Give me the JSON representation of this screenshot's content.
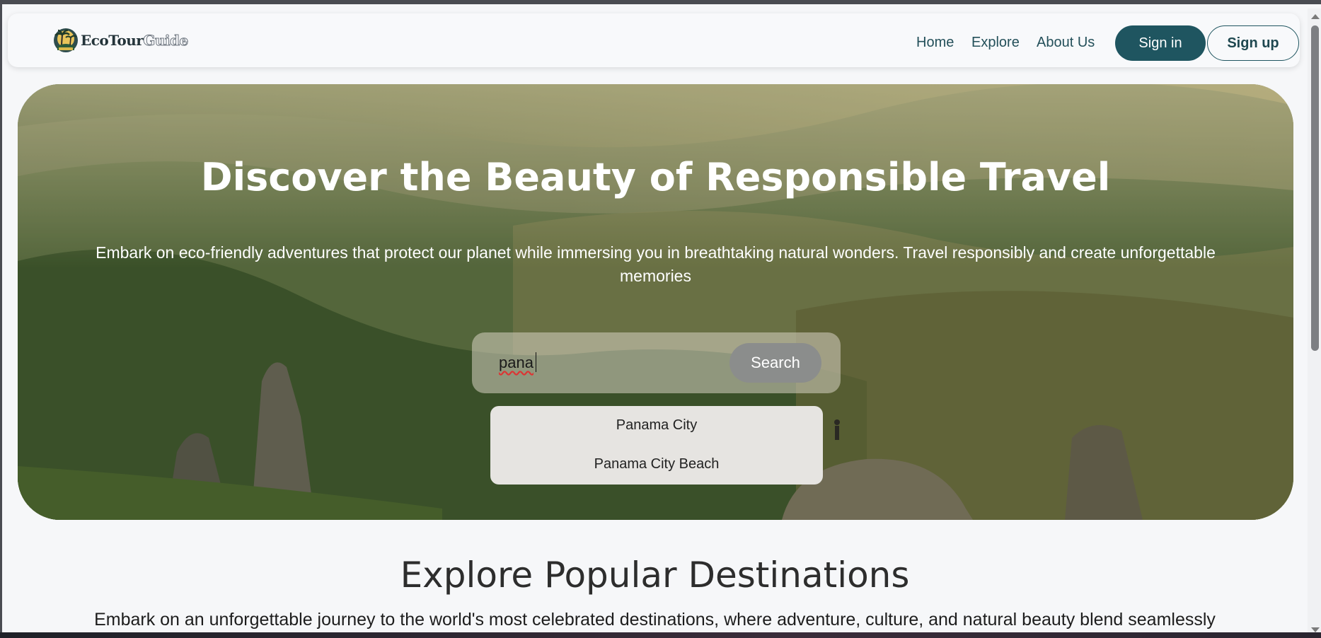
{
  "navbar": {
    "logo_text_1": "EcoTour",
    "logo_text_2": "Guide",
    "links": [
      "Home",
      "Explore",
      "About Us"
    ],
    "signin_label": "Sign in",
    "signup_label": "Sign up"
  },
  "hero": {
    "title": "Discover the Beauty of Responsible Travel",
    "subtitle": "Embark on eco-friendly adventures that protect our planet while immersing you in breathtaking natural wonders. Travel responsibly and create unforgettable memories",
    "search": {
      "value": "pana",
      "button_label": "Search"
    },
    "suggestions": [
      "Panama City",
      "Panama City Beach"
    ]
  },
  "section": {
    "title": "Explore Popular Destinations",
    "subtitle": "Embark on an unforgettable journey to the world's most celebrated destinations, where adventure, culture, and natural beauty blend seamlessly"
  },
  "colors": {
    "accent": "#1f5560",
    "page_bg": "#f6f7f9"
  }
}
